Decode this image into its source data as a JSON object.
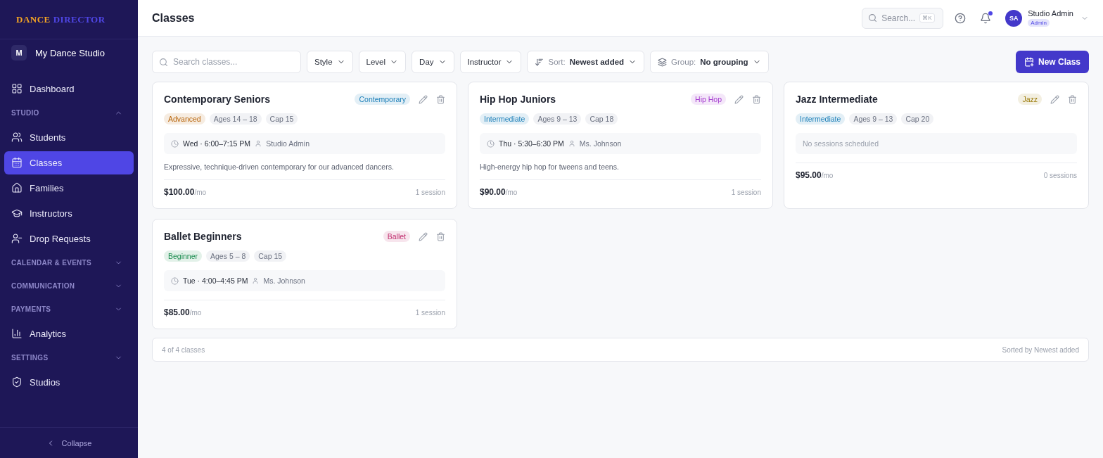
{
  "brand": {
    "first": "DANCE",
    "second": "DIRECTOR"
  },
  "studio": {
    "initial": "M",
    "name": "My Dance Studio"
  },
  "sidebar": {
    "items": [
      {
        "kind": "nav",
        "label": "Dashboard",
        "selected": false
      },
      {
        "kind": "section",
        "label": "STUDIO",
        "expanded": true
      },
      {
        "kind": "nav",
        "label": "Students",
        "selected": false
      },
      {
        "kind": "nav",
        "label": "Classes",
        "selected": true
      },
      {
        "kind": "nav",
        "label": "Families",
        "selected": false
      },
      {
        "kind": "nav",
        "label": "Instructors",
        "selected": false
      },
      {
        "kind": "nav",
        "label": "Drop Requests",
        "selected": false
      },
      {
        "kind": "section",
        "label": "CALENDAR & EVENTS",
        "expanded": false
      },
      {
        "kind": "section",
        "label": "COMMUNICATION",
        "expanded": false
      },
      {
        "kind": "section",
        "label": "PAYMENTS",
        "expanded": false
      },
      {
        "kind": "nav",
        "label": "Analytics",
        "selected": false
      },
      {
        "kind": "section",
        "label": "SETTINGS",
        "expanded": false
      },
      {
        "kind": "nav",
        "label": "Studios",
        "selected": false
      }
    ],
    "collapse": "Collapse"
  },
  "header": {
    "title": "Classes",
    "search": {
      "placeholder": "Search...",
      "shortcut": "⌘K"
    },
    "notification_dot": true,
    "user": {
      "initials": "SA",
      "name": "Studio Admin",
      "role": "Admin"
    }
  },
  "toolbar": {
    "search": {
      "placeholder": "Search classes..."
    },
    "filters": [
      "Style",
      "Level",
      "Day",
      "Instructor"
    ],
    "sort": {
      "label": "Sort:",
      "value": "Newest added"
    },
    "group": {
      "label": "Group:",
      "value": "No grouping"
    },
    "new_button": "New Class"
  },
  "classes": [
    {
      "title": "Contemporary Seniors",
      "style": {
        "label": "Contemporary",
        "color": "#1b7fb8"
      },
      "level": {
        "label": "Advanced",
        "color": "#b8650b"
      },
      "ages": "Ages 14 – 18",
      "cap": "Cap 15",
      "schedule": {
        "time": "Wed · 6:00–7:15 PM",
        "instructor": "Studio Admin"
      },
      "description": "Expressive, technique-driven contemporary for our advanced dancers.",
      "price": "$100.00",
      "per": "/mo",
      "sessions": "1 session"
    },
    {
      "title": "Hip Hop Juniors",
      "style": {
        "label": "Hip Hop",
        "color": "#a43ccf"
      },
      "level": {
        "label": "Intermediate",
        "color": "#1b7fb8"
      },
      "ages": "Ages 9 – 13",
      "cap": "Cap 18",
      "schedule": {
        "time": "Thu · 5:30–6:30 PM",
        "instructor": "Ms. Johnson"
      },
      "description": "High-energy hip hop for tweens and teens.",
      "price": "$90.00",
      "per": "/mo",
      "sessions": "1 session"
    },
    {
      "title": "Jazz Intermediate",
      "style": {
        "label": "Jazz",
        "color": "#9a7a08"
      },
      "level": {
        "label": "Intermediate",
        "color": "#1b7fb8"
      },
      "ages": "Ages 9 – 13",
      "cap": "Cap 20",
      "empty_schedule": "No sessions scheduled",
      "price": "$95.00",
      "per": "/mo",
      "sessions": "0 sessions"
    },
    {
      "title": "Ballet Beginners",
      "style": {
        "label": "Ballet",
        "color": "#c02d6e"
      },
      "level": {
        "label": "Beginner",
        "color": "#178a4c"
      },
      "ages": "Ages 5 – 8",
      "cap": "Cap 15",
      "schedule": {
        "time": "Tue · 4:00–4:45 PM",
        "instructor": "Ms. Johnson"
      },
      "price": "$85.00",
      "per": "/mo",
      "sessions": "1 session"
    }
  ],
  "footer": {
    "count": "4 of 4 classes",
    "sorted": "Sorted by Newest added"
  }
}
